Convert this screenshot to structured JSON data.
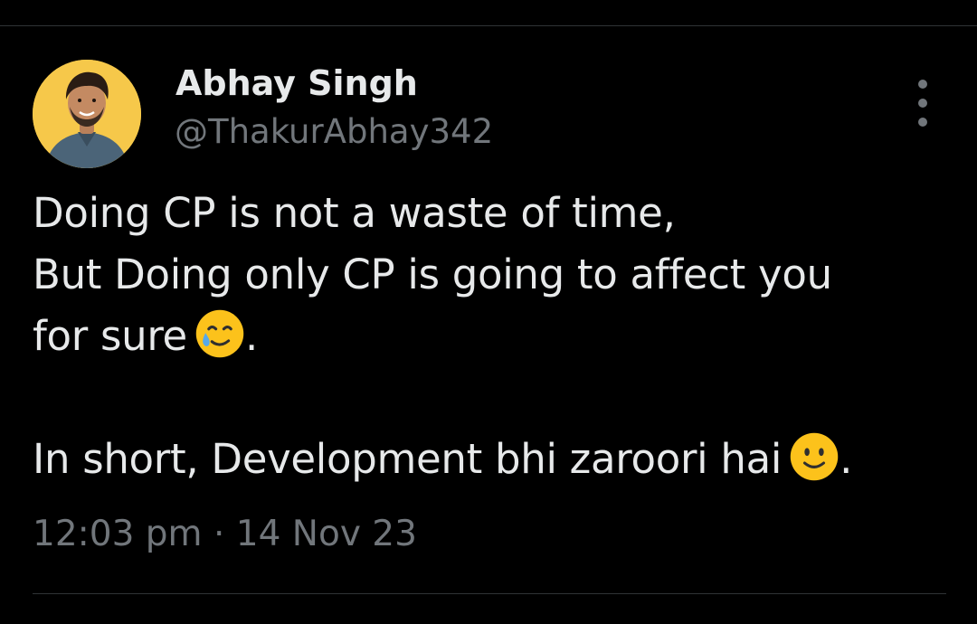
{
  "author": {
    "display_name": "Abhay Singh",
    "handle": "@ThakurAbhay342"
  },
  "tweet": {
    "line1": "Doing CP is not a waste of time,",
    "line2": "But Doing only CP is going to affect you",
    "line3_text": "for sure",
    "line3_emoji": "smiling-face-with-tear",
    "line3_end": ".",
    "line5_text": "In short, Development bhi zaroori hai",
    "line5_emoji": "slightly-smiling-face",
    "line5_end": "."
  },
  "meta": {
    "time": "12:03 pm",
    "separator": "·",
    "date": "14 Nov 23"
  },
  "icons": {
    "more": "more-vertical-icon"
  },
  "colors": {
    "background": "#000000",
    "text_primary": "#e7e9ea",
    "text_secondary": "#71767b",
    "avatar_bg": "#f6c84a",
    "emoji_yellow": "#fcc21b"
  }
}
